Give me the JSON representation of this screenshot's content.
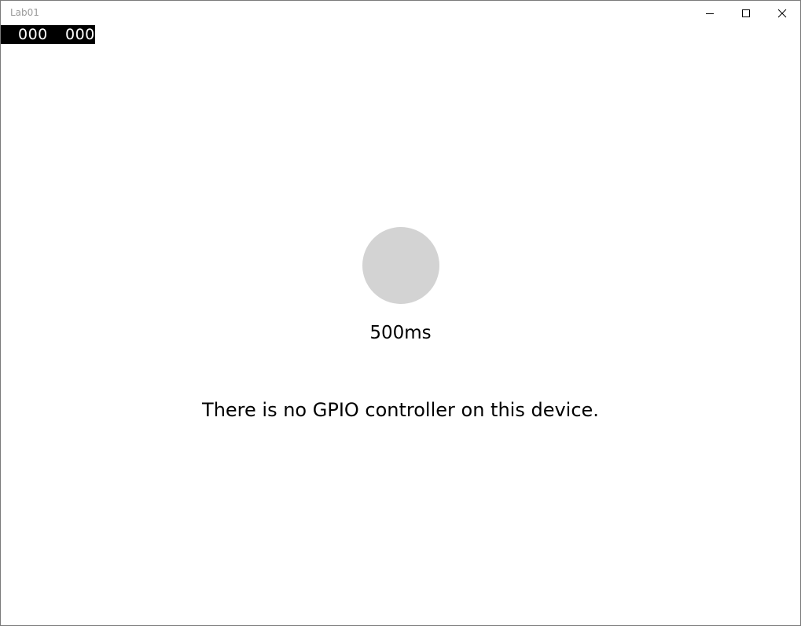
{
  "window": {
    "title": "Lab01",
    "controls": {
      "minimize_icon": "minimize-icon",
      "maximize_icon": "maximize-icon",
      "close_icon": "close-icon"
    }
  },
  "frame_counter": {
    "left": "000",
    "right": "000"
  },
  "led": {
    "color": "#d3d3d3"
  },
  "delay": {
    "text": "500ms"
  },
  "status": {
    "text": "There is no GPIO controller on this device."
  }
}
